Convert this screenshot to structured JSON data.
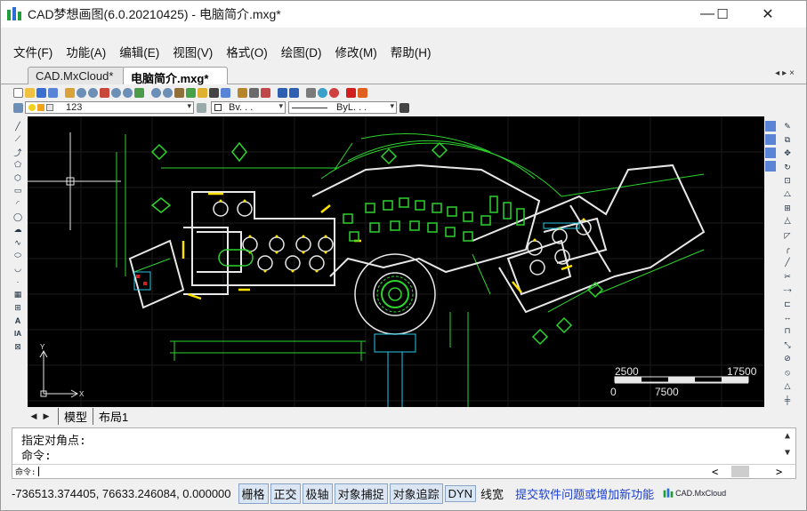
{
  "window": {
    "title": "CAD梦想画图(6.0.20210425) - 电脑简介.mxg*",
    "minimize": "—",
    "maximize": "☐",
    "close": "✕"
  },
  "menu": [
    "文件(F)",
    "功能(A)",
    "编辑(E)",
    "视图(V)",
    "格式(O)",
    "绘图(D)",
    "修改(M)",
    "帮助(H)"
  ],
  "doc_tabs": [
    {
      "label": "CAD.MxCloud*",
      "active": false
    },
    {
      "label": "电脑简介.mxg*",
      "active": true
    }
  ],
  "tab_controls": "◂▸×",
  "layer_toolbar": {
    "layer_name": "123",
    "color_value": "Bv. . .",
    "linetype_value": "ByL. . ."
  },
  "scale_bar": {
    "top_left": "2500",
    "top_right": "17500",
    "bottom_left": "0",
    "bottom_right": "7500"
  },
  "layout_tabs": {
    "model": "模型",
    "layout1": "布局1"
  },
  "command": {
    "history": [
      "指定对角点:",
      "命令:"
    ],
    "prompt_label": "命令:",
    "scroll_up": "▲",
    "scroll_down": "▼",
    "scroll_left": "<",
    "scroll_right": ">"
  },
  "status": {
    "coordinates": "-736513.374405, 76633.246084, 0.000000",
    "toggles": [
      "栅格",
      "正交",
      "极轴",
      "对象捕捉",
      "对象追踪",
      "DYN"
    ],
    "lineweight": "线宽",
    "feedback_link": "提交软件问题或增加新功能",
    "brand": "CAD.MxCloud"
  },
  "colors": {
    "canvas_bg": "#000000",
    "cad_green": "#2ed42e",
    "cad_white": "#e8e8e8",
    "cad_yellow": "#ffe200",
    "cad_cyan": "#29c8e8",
    "link_blue": "#1a3fd1",
    "status_toggle_bg": "#dbe6f4"
  },
  "icons": {
    "app_logo": "cad-dream-logo-icon",
    "ucs": "ucs-axis-icon"
  }
}
